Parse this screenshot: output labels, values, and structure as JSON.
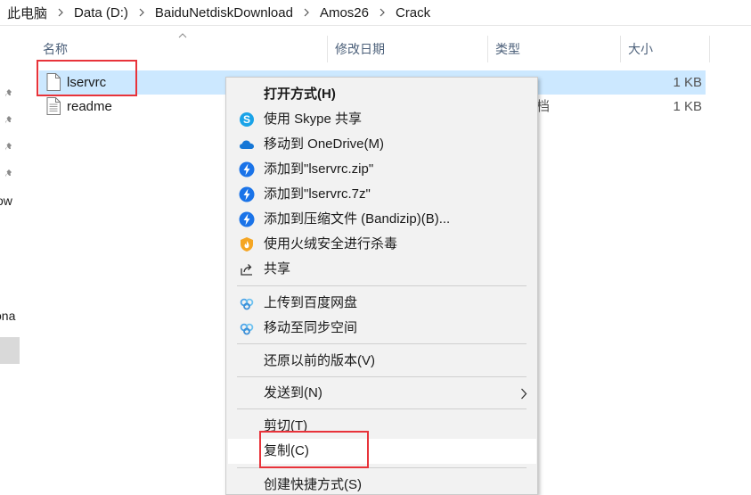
{
  "breadcrumb": {
    "items": [
      "此电脑",
      "Data (D:)",
      "BaiduNetdiskDownload",
      "Amos26",
      "Crack"
    ]
  },
  "nav": {
    "partial_texts": [
      "ow",
      "ona"
    ]
  },
  "columns": {
    "name": "名称",
    "date": "修改日期",
    "type": "类型",
    "size": "大小"
  },
  "files": [
    {
      "name": "lservrc",
      "type": "",
      "size": "1 KB",
      "selected": true
    },
    {
      "name": "readme",
      "type": "档",
      "size": "1 KB",
      "selected": false
    }
  ],
  "context_menu": {
    "items": [
      {
        "label": "打开方式(H)",
        "icon": "none",
        "bold": true
      },
      {
        "label": "使用 Skype 共享",
        "icon": "skype-icon"
      },
      {
        "label": "移动到 OneDrive(M)",
        "icon": "onedrive-icon"
      },
      {
        "label": "添加到\"lservrc.zip\"",
        "icon": "bandizip-icon"
      },
      {
        "label": "添加到\"lservrc.7z\"",
        "icon": "bandizip-icon"
      },
      {
        "label": "添加到压缩文件 (Bandizip)(B)...",
        "icon": "bandizip-icon"
      },
      {
        "label": "使用火绒安全进行杀毒",
        "icon": "huorong-icon"
      },
      {
        "label": "共享",
        "icon": "share-icon"
      },
      {
        "label": "上传到百度网盘",
        "icon": "baidu-netdisk-icon"
      },
      {
        "label": "移动至同步空间",
        "icon": "baidu-netdisk-icon"
      },
      {
        "label": "还原以前的版本(V)",
        "icon": "none"
      },
      {
        "label": "发送到(N)",
        "icon": "none",
        "submenu": true
      },
      {
        "label": "剪切(T)",
        "icon": "none"
      },
      {
        "label": "复制(C)",
        "icon": "none",
        "hovered": true
      },
      {
        "label": "创建快捷方式(S)",
        "icon": "none"
      }
    ]
  },
  "colors": {
    "selection": "#cce8ff",
    "highlight_box": "#e8333a",
    "menu_bg": "#f2f2f2",
    "skype": "#1aa3e8",
    "onedrive": "#1677d6",
    "bandizip": "#1a73e8",
    "huorong": "#f5a623"
  }
}
